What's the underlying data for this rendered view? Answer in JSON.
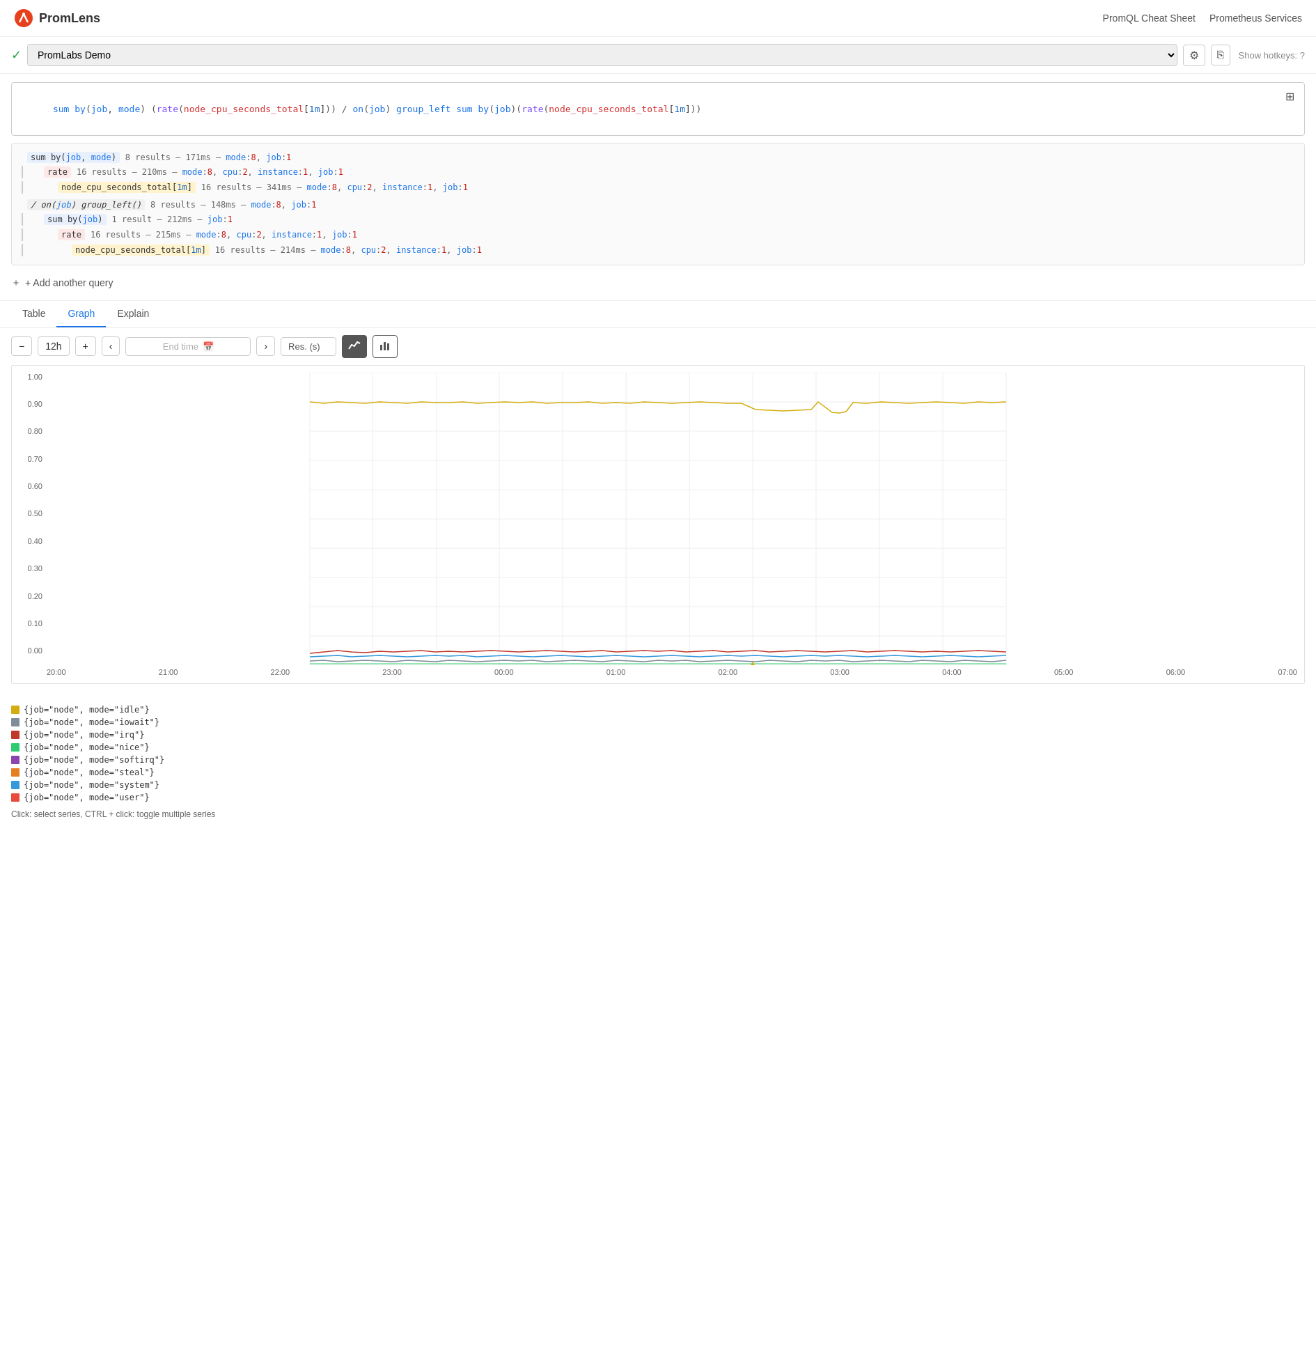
{
  "header": {
    "logo_text": "PromLens",
    "nav": [
      {
        "label": "PromQL Cheat Sheet",
        "url": "#"
      },
      {
        "label": "Prometheus Services",
        "url": "#"
      }
    ]
  },
  "toolbar": {
    "server": "PromLabs Demo",
    "hotkeys": "Show hotkeys: ?"
  },
  "query": {
    "expression": "sum by(job, mode) (rate(node_cpu_seconds_total[1m])) / on(job) group_left sum by(job)(rate(node_cpu_seconds_total[1m]))"
  },
  "expr_tree": {
    "nodes": [
      {
        "depth": 0,
        "label": "sum by(job, mode)",
        "type": "agg",
        "stats": "8 results – 171ms –",
        "labels": [
          {
            "k": "mode",
            "v": "8"
          },
          {
            "k": "job",
            "v": "1"
          }
        ]
      },
      {
        "depth": 1,
        "label": "rate",
        "type": "fn",
        "stats": "16 results – 210ms –",
        "labels": [
          {
            "k": "mode",
            "v": "8"
          },
          {
            "k": "cpu",
            "v": "2"
          },
          {
            "k": "instance",
            "v": "1"
          },
          {
            "k": "job",
            "v": "1"
          }
        ]
      },
      {
        "depth": 2,
        "label": "node_cpu_seconds_total[1m]",
        "type": "metric",
        "stats": "16 results – 341ms –",
        "labels": [
          {
            "k": "mode",
            "v": "8"
          },
          {
            "k": "cpu",
            "v": "2"
          },
          {
            "k": "instance",
            "v": "1"
          },
          {
            "k": "job",
            "v": "1"
          }
        ]
      },
      {
        "depth": 0,
        "label": "/ on(job) group_left()",
        "type": "op",
        "stats": "8 results – 148ms –",
        "labels": [
          {
            "k": "mode",
            "v": "8"
          },
          {
            "k": "job",
            "v": "1"
          }
        ]
      },
      {
        "depth": 1,
        "label": "sum by(job)",
        "type": "agg",
        "stats": "1 result – 212ms –",
        "labels": [
          {
            "k": "job",
            "v": "1"
          }
        ]
      },
      {
        "depth": 2,
        "label": "rate",
        "type": "fn",
        "stats": "16 results – 215ms –",
        "labels": [
          {
            "k": "mode",
            "v": "8"
          },
          {
            "k": "cpu",
            "v": "2"
          },
          {
            "k": "instance",
            "v": "1"
          },
          {
            "k": "job",
            "v": "1"
          }
        ]
      },
      {
        "depth": 3,
        "label": "node_cpu_seconds_total[1m]",
        "type": "metric",
        "stats": "16 results – 214ms –",
        "labels": [
          {
            "k": "mode",
            "v": "8"
          },
          {
            "k": "cpu",
            "v": "2"
          },
          {
            "k": "instance",
            "v": "1"
          },
          {
            "k": "job",
            "v": "1"
          }
        ]
      }
    ]
  },
  "add_query": "+ Add another query",
  "tabs": [
    {
      "label": "Table",
      "active": false
    },
    {
      "label": "Graph",
      "active": true
    },
    {
      "label": "Explain",
      "active": false
    }
  ],
  "graph_controls": {
    "minus": "−",
    "duration": "12h",
    "plus": "+",
    "prev": "‹",
    "end_time_placeholder": "End time",
    "next": "›",
    "resolution_label": "Res. (s)",
    "view_line": "📈",
    "view_bar": "📊"
  },
  "chart": {
    "y_labels": [
      "1.00",
      "0.90",
      "0.80",
      "0.70",
      "0.60",
      "0.50",
      "0.40",
      "0.30",
      "0.20",
      "0.10",
      "0.00"
    ],
    "x_labels": [
      "20:00",
      "21:00",
      "22:00",
      "23:00",
      "00:00",
      "01:00",
      "02:00",
      "03:00",
      "04:00",
      "05:00",
      "06:00",
      "07:00"
    ]
  },
  "legend": {
    "items": [
      {
        "label": "{job=\"node\", mode=\"idle\"}",
        "color": "#d4ac0d"
      },
      {
        "label": "{job=\"node\", mode=\"iowait\"}",
        "color": "#7f8c9a"
      },
      {
        "label": "{job=\"node\", mode=\"irq\"}",
        "color": "#c0392b"
      },
      {
        "label": "{job=\"node\", mode=\"nice\"}",
        "color": "#2ecc71"
      },
      {
        "label": "{job=\"node\", mode=\"softirq\"}",
        "color": "#8e44ad"
      },
      {
        "label": "{job=\"node\", mode=\"steal\"}",
        "color": "#e67e22"
      },
      {
        "label": "{job=\"node\", mode=\"system\"}",
        "color": "#3498db"
      },
      {
        "label": "{job=\"node\", mode=\"user\"}",
        "color": "#e74c3c"
      }
    ],
    "hint": "Click: select series, CTRL + click: toggle multiple series"
  }
}
